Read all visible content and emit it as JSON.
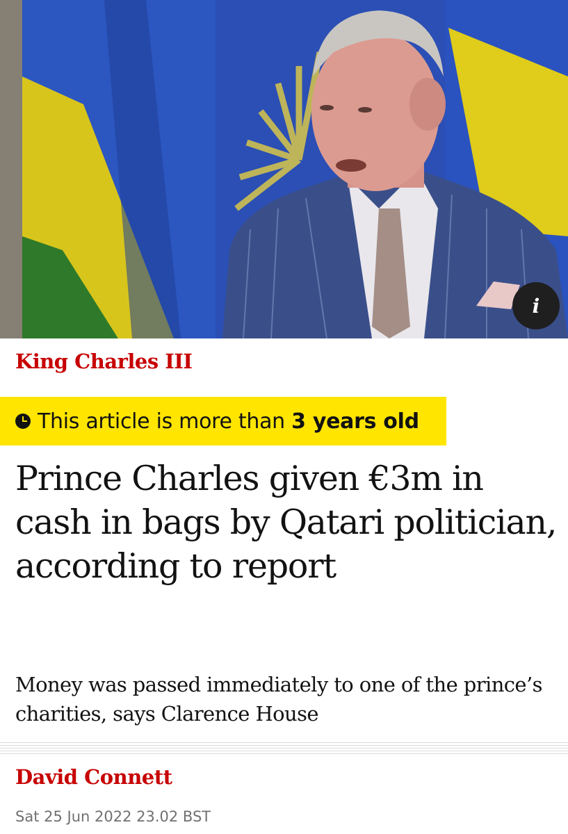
{
  "hero": {
    "info_icon": "info-icon",
    "info_glyph": "i"
  },
  "article": {
    "section": "King Charles III",
    "age_notice": {
      "prefix": "This article is more than ",
      "age": "3 years old",
      "icon": "clock-icon",
      "background": "#ffe500"
    },
    "headline": "Prince Charles given €3m in cash in bags by Qatari politician, according to report",
    "standfirst": "Money was passed immediately to one of the prince’s charities, says Clarence House",
    "author": "David Connett",
    "published": "Sat 25 Jun 2022 23.02 BST"
  },
  "colors": {
    "accent": "#c70000",
    "text": "#121212",
    "muted": "#707070"
  }
}
